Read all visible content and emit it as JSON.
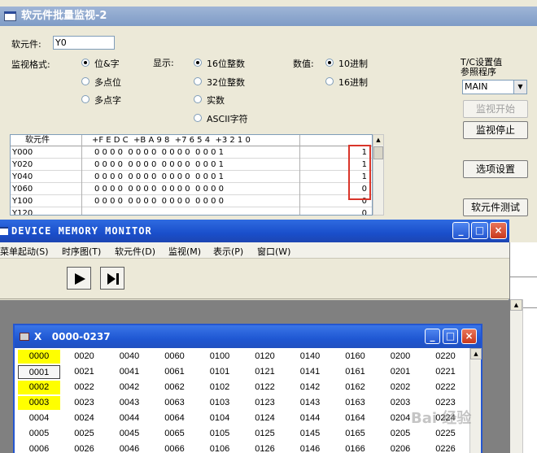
{
  "batch_monitor": {
    "title": "软元件批量监视-2",
    "device_label": "软元件:",
    "device_value": "Y0",
    "monitor_format_label": "监视格式:",
    "format_options": [
      "位&字",
      "多点位",
      "多点字"
    ],
    "display_label": "显示:",
    "display_options": [
      "16位整数",
      "32位整数",
      "实数",
      "ASCII字符"
    ],
    "value_label": "数值:",
    "value_options": [
      "10进制",
      "16进制"
    ],
    "tc_label_1": "T/C设置值",
    "tc_label_2": "参照程序",
    "program_select": "MAIN",
    "buttons": {
      "start": "监视开始",
      "stop": "监视停止",
      "options": "选项设置",
      "test": "软元件测试"
    },
    "table": {
      "col_device": "软元件",
      "col_bits": "+F E D C  +B A 9 8  +7 6 5 4  +3 2 1 0",
      "rows": [
        {
          "device": "Y000",
          "bits": "0 0 0 0  0 0 0 0  0 0 0 0  0 0 0 1",
          "value": "1"
        },
        {
          "device": "Y020",
          "bits": "0 0 0 0  0 0 0 0  0 0 0 0  0 0 0 1",
          "value": "1"
        },
        {
          "device": "Y040",
          "bits": "0 0 0 0  0 0 0 0  0 0 0 0  0 0 0 1",
          "value": "1"
        },
        {
          "device": "Y060",
          "bits": "0 0 0 0  0 0 0 0  0 0 0 0  0 0 0 0",
          "value": "0"
        },
        {
          "device": "Y100",
          "bits": "0 0 0 0  0 0 0 0  0 0 0 0  0 0 0 0",
          "value": "0"
        },
        {
          "device": "Y120",
          "bits": "",
          "value": "0"
        }
      ]
    }
  },
  "memory_monitor": {
    "title": "DEVICE MEMORY MONITOR",
    "menu": [
      "菜单起动(S)",
      "时序图(T)",
      "软元件(D)",
      "监视(M)",
      "表示(P)",
      "窗口(W)"
    ],
    "caption_buttons": {
      "minimize": "_",
      "maximize": "□",
      "close": "×"
    }
  },
  "x_window": {
    "title": "X   0000-0237",
    "columns": [
      [
        "0000",
        "0001",
        "0002",
        "0003",
        "0004",
        "0005",
        "0006"
      ],
      [
        "0020",
        "0021",
        "0022",
        "0023",
        "0024",
        "0025",
        "0026"
      ],
      [
        "0040",
        "0041",
        "0042",
        "0043",
        "0044",
        "0045",
        "0046"
      ],
      [
        "0060",
        "0061",
        "0062",
        "0063",
        "0064",
        "0065",
        "0066"
      ],
      [
        "0100",
        "0101",
        "0102",
        "0103",
        "0104",
        "0105",
        "0106"
      ],
      [
        "0120",
        "0121",
        "0122",
        "0123",
        "0124",
        "0125",
        "0126"
      ],
      [
        "0140",
        "0141",
        "0142",
        "0143",
        "0144",
        "0145",
        "0146"
      ],
      [
        "0160",
        "0161",
        "0162",
        "0163",
        "0164",
        "0165",
        "0166"
      ],
      [
        "0200",
        "0201",
        "0202",
        "0203",
        "0204",
        "0205",
        "0206"
      ],
      [
        "0220",
        "0221",
        "0222",
        "0223",
        "0224",
        "0225",
        "0226"
      ]
    ],
    "on_cells": [
      "0000",
      "0002",
      "0003"
    ],
    "focus_cell": "0001"
  },
  "watermark": "Bai 经验"
}
